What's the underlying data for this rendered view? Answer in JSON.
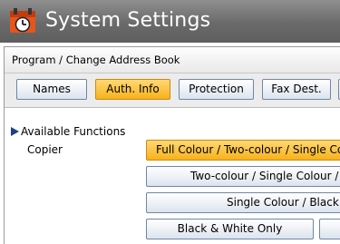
{
  "window": {
    "title": "System Settings",
    "icon": "settings-app-icon"
  },
  "breadcrumb": "Program / Change Address Book",
  "tabs": [
    {
      "label": "Names",
      "selected": false
    },
    {
      "label": "Auth. Info",
      "selected": true
    },
    {
      "label": "Protection",
      "selected": false
    },
    {
      "label": "Fax Dest.",
      "selected": false
    }
  ],
  "section": {
    "label": "Available Functions"
  },
  "copier": {
    "label": "Copier",
    "options": [
      {
        "label": "Full Colour / Two-colour / Single Colour",
        "selected": true
      },
      {
        "label": "Two-colour / Single Colour / Black & White",
        "selected": false
      },
      {
        "label": "Single Colour / Black & White",
        "selected": false
      },
      {
        "label": "Black & White Only",
        "selected": false
      }
    ]
  },
  "colors": {
    "accent": "#f7b21b",
    "titlebar": "#6e6e6e",
    "button_border": "#6f86a8"
  }
}
